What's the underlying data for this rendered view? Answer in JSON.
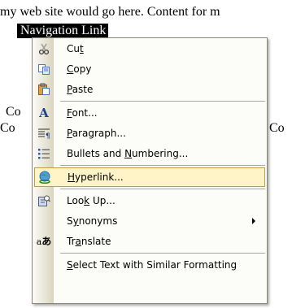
{
  "document": {
    "line1": " my web site would go here. Content for m",
    "nav_link": "Navigation Link",
    "frag_a": "Co",
    "frag_b": "Co",
    "frag_c": "Co"
  },
  "context_menu": {
    "items": [
      {
        "pre": "Cu",
        "key": "t",
        "post": "",
        "icon": "scissors-icon"
      },
      {
        "pre": "",
        "key": "C",
        "post": "opy",
        "icon": "copy-icon"
      },
      {
        "pre": "",
        "key": "P",
        "post": "aste",
        "icon": "paste-icon"
      },
      {
        "pre": "",
        "key": "F",
        "post": "ont...",
        "icon": "font-icon"
      },
      {
        "pre": "",
        "key": "P",
        "post": "aragraph...",
        "icon": "paragraph-icon"
      },
      {
        "pre": "Bullets and ",
        "key": "N",
        "post": "umbering...",
        "icon": "bullets-icon"
      },
      {
        "pre": "",
        "key": "H",
        "post": "yperlink...",
        "icon": "hyperlink-icon"
      },
      {
        "pre": "Loo",
        "key": "k",
        "post": " Up...",
        "icon": "research-book-icon"
      },
      {
        "pre": "S",
        "key": "y",
        "post": "nonyms",
        "icon": ""
      },
      {
        "pre": "Tr",
        "key": "a",
        "post": "nslate",
        "icon": "translate-icon"
      },
      {
        "pre": "",
        "key": "S",
        "post": "elect Text with Similar Formatting",
        "icon": ""
      }
    ],
    "highlight_color": "#fff3c8",
    "highlight_border": "#c79a48"
  }
}
